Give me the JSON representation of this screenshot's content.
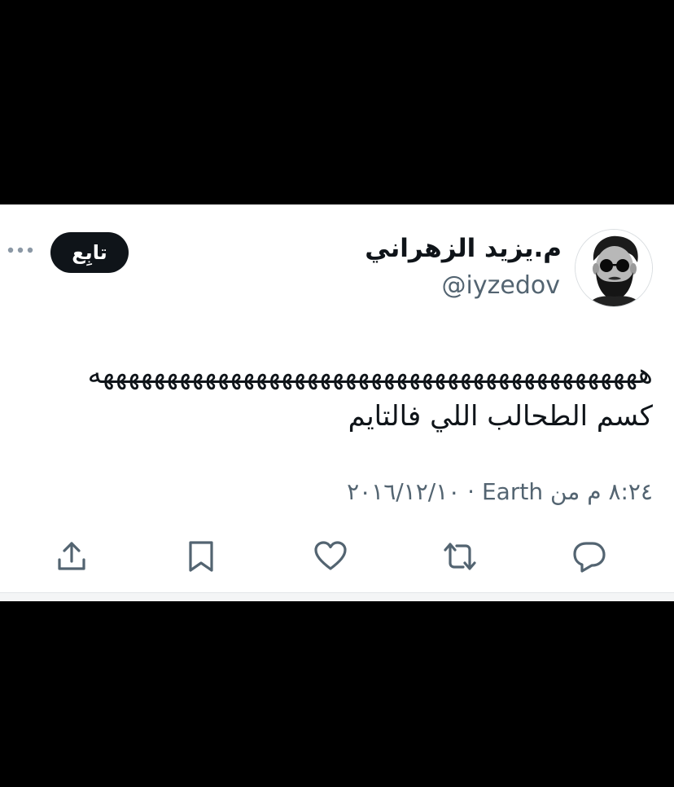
{
  "tweet": {
    "display_name": "م.يزيد الزهراني",
    "handle": "@iyzedov",
    "follow_label": "تابِع",
    "text_line_1": "هههههههههههههههههههههههههههههههههههههههههههه",
    "text_line_2": "كسم الطحالب اللي فالتايم",
    "meta": "٨:٢٤ م من Earth · ٢٠١٦/١٢/١٠",
    "avatar_description": "man with dark sunglasses and beard"
  },
  "icons": {
    "more": "more-horizontal-icon",
    "share": "share-icon",
    "bookmark": "bookmark-icon",
    "like": "heart-icon",
    "retweet": "retweet-icon",
    "reply": "reply-icon"
  },
  "colors": {
    "text_primary": "#0f1419",
    "text_secondary": "#536471",
    "follow_button_bg": "#0f1419",
    "background": "#ffffff",
    "frame": "#000000"
  }
}
